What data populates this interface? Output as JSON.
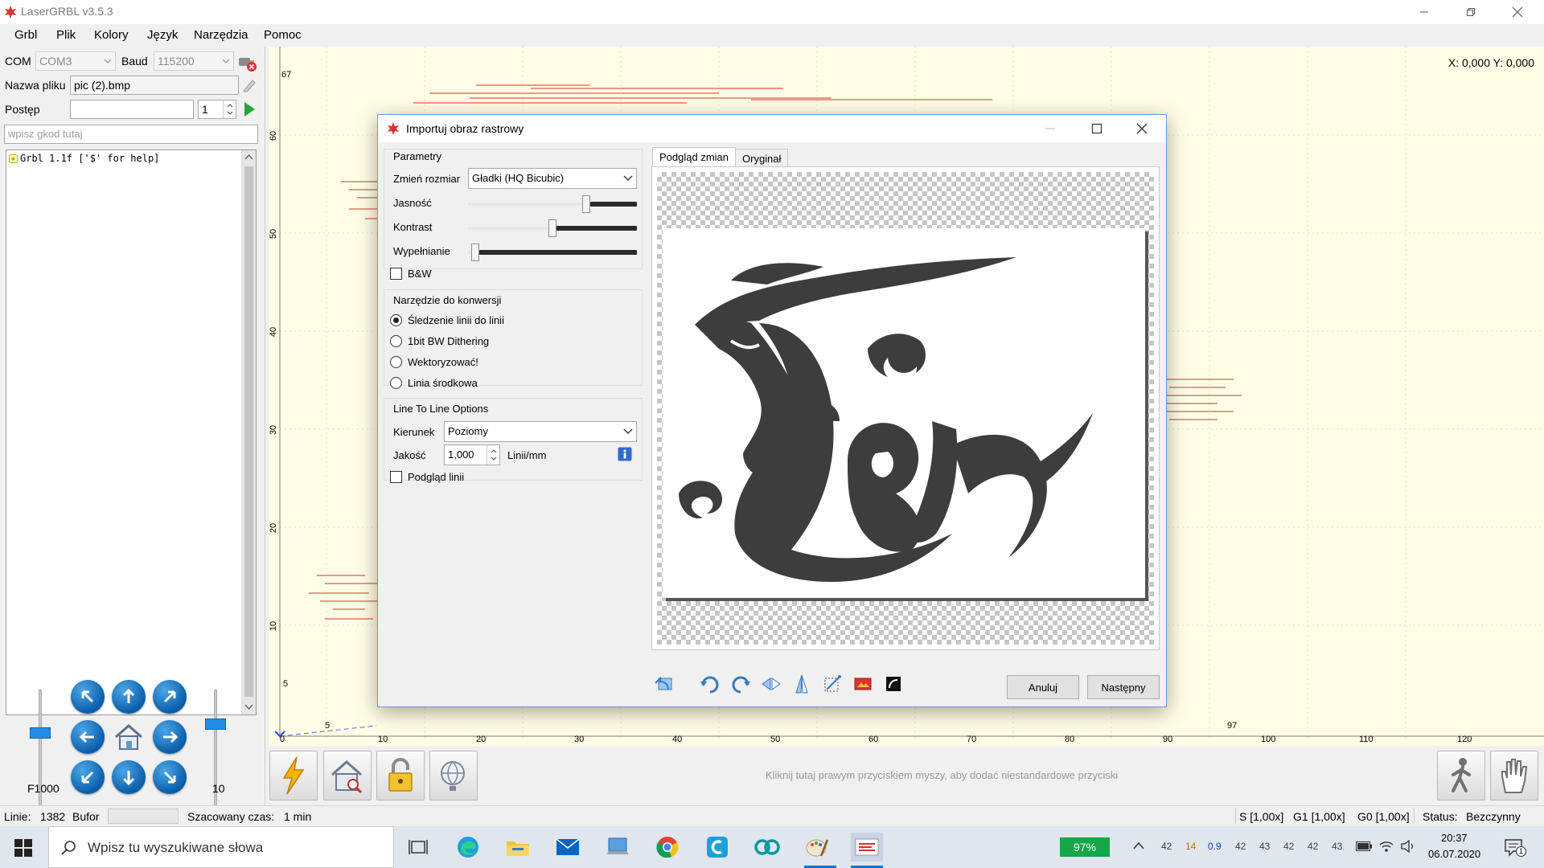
{
  "app": {
    "title": "LaserGRBL v3.5.3"
  },
  "menu": [
    "Grbl",
    "Plik",
    "Kolory",
    "Język",
    "Narzędzia",
    "Pomoc"
  ],
  "connection": {
    "com_label": "COM",
    "com_value": "COM3",
    "baud_label": "Baud",
    "baud_value": "115200"
  },
  "file": {
    "label": "Nazwa pliku",
    "value": "pic (2).bmp"
  },
  "progress": {
    "label": "Postęp",
    "copies": "1"
  },
  "gcode_input": {
    "placeholder": "wpisz gkod tutaj"
  },
  "console": {
    "lines": [
      "Grbl 1.1f ['$' for help]"
    ]
  },
  "jog": {
    "feed_label": "F1000",
    "step_label": "10"
  },
  "workspace": {
    "coords": "X: 0,000 Y: 0,000",
    "y_top": "67",
    "y_ticks": [
      "60",
      "50",
      "40",
      "30",
      "20",
      "10",
      "5"
    ],
    "x_ticks": [
      "0",
      "10",
      "20",
      "30",
      "40",
      "50",
      "60",
      "70",
      "80",
      "90",
      "100",
      "110",
      "120"
    ],
    "x_top_5": "5",
    "x_top_97": "97"
  },
  "custom_buttons_hint": "Kliknij tutaj prawym przyciskiem myszy, aby dodać niestandardowe przyciski",
  "status": {
    "lines_label": "Linie:",
    "lines_value": "1382",
    "buffer_label": "Bufor",
    "time_label": "Szacowany czas:",
    "time_value": "1 min",
    "s_override": "S [1,00x]",
    "g1_override": "G1 [1,00x]",
    "g0_override": "G0 [1,00x]",
    "state_label": "Status:",
    "state_value": "Bezczynny"
  },
  "dialog": {
    "title": "Importuj obraz rastrowy",
    "params_group": "Parametry",
    "resize_label": "Zmień rozmiar",
    "resize_value": "Gładki (HQ Bicubic)",
    "brightness_label": "Jasność",
    "contrast_label": "Kontrast",
    "fill_label": "Wypełnianie",
    "bw_label": "B&W",
    "brightness_level": 0.71,
    "contrast_level": 0.5,
    "fill_level": 0.02,
    "tool_group": "Narzędzie do konwersji",
    "tools": [
      "Śledzenie linii do linii",
      "1bit BW Dithering",
      "Wektoryzować!",
      "Linia środkowa"
    ],
    "selected_tool": 0,
    "l2l_group": "Line To Line Options",
    "direction_label": "Kierunek",
    "direction_value": "Poziomy",
    "quality_label": "Jakość",
    "quality_value": "1,000",
    "quality_unit": "Linii/mm",
    "preview_lines_label": "Podgląd linii",
    "tab_preview": "Podgląd zmian",
    "tab_original": "Oryginał",
    "cancel": "Anuluj",
    "next": "Następny"
  },
  "taskbar": {
    "search_placeholder": "Wpisz tu wyszukiwane słowa",
    "battery": "97%",
    "tray_numbers": [
      "42",
      "14",
      "0.9",
      "42",
      "43",
      "42",
      "42",
      "43"
    ],
    "time": "20:37",
    "date": "06.07.2020",
    "notifications": "1"
  },
  "colors": {
    "accent": "#0078d7",
    "workspace_bg": "#fffde6",
    "laser_path": "#e03020"
  }
}
